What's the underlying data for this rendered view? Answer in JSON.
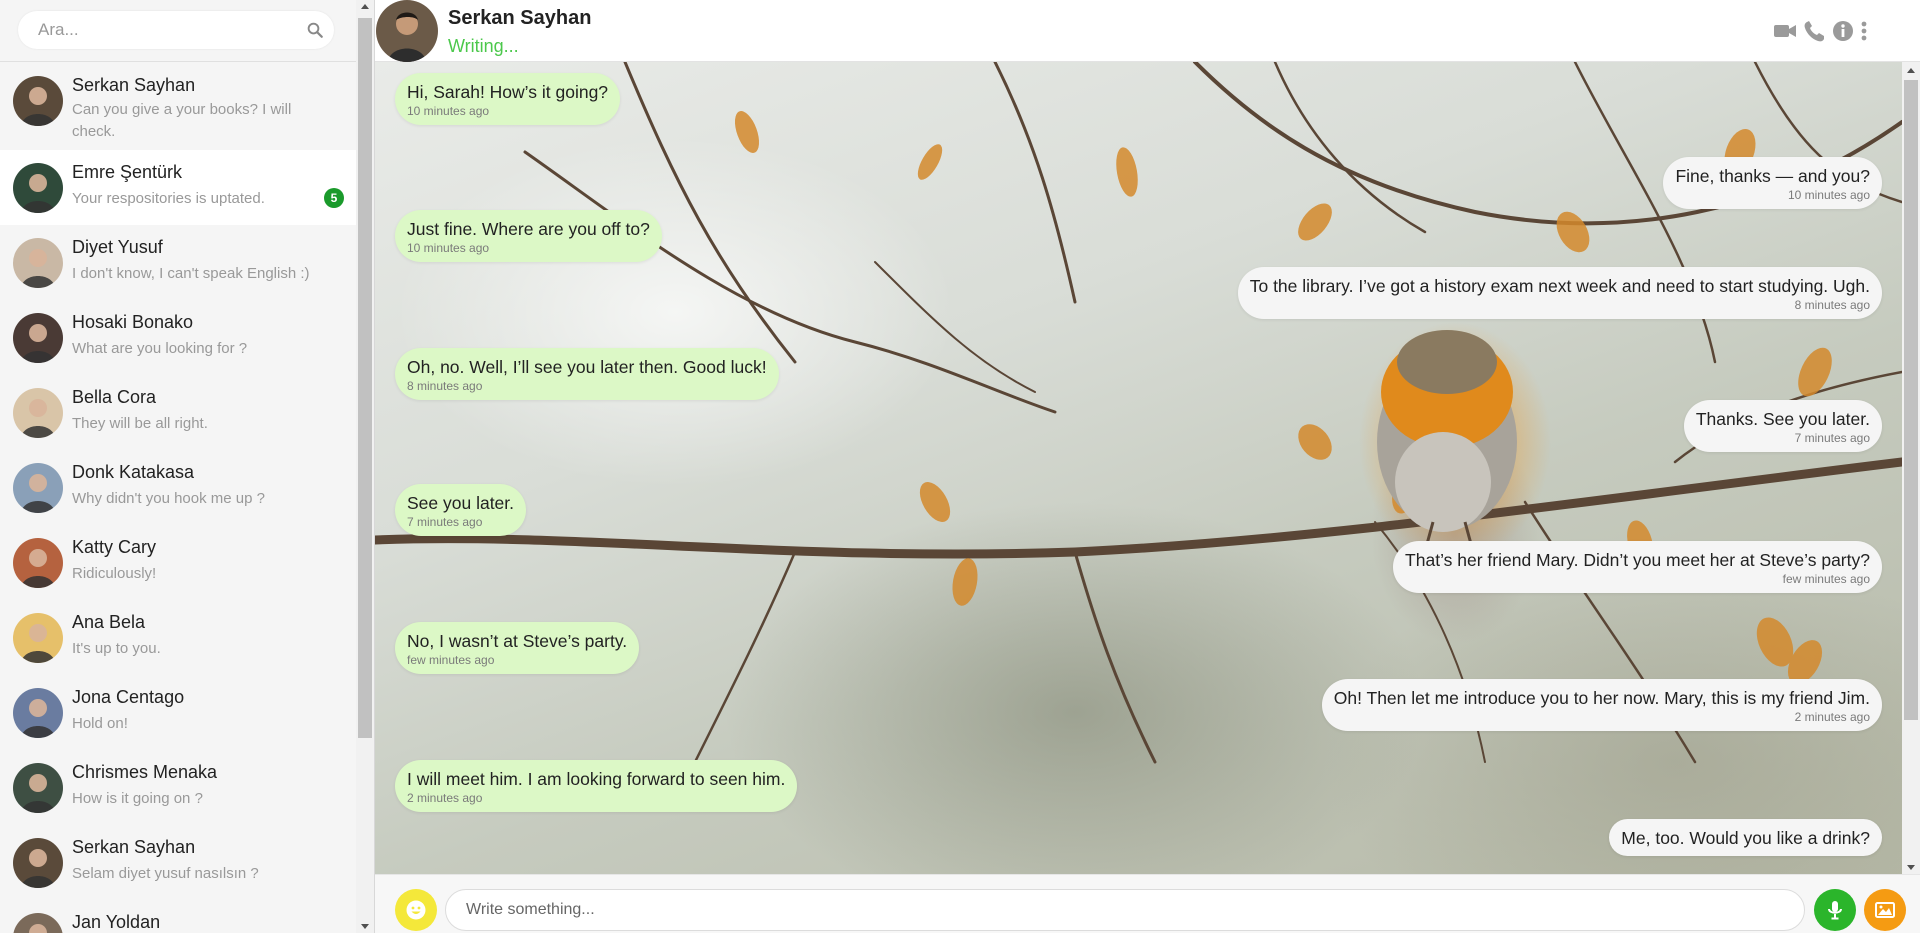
{
  "search": {
    "placeholder": "Ara..."
  },
  "contacts": [
    {
      "name": "Serkan Sayhan",
      "last": "Can you give a your books? I will check.",
      "avatar": "#5a4a3a",
      "active": false
    },
    {
      "name": "Emre Şentürk",
      "last": "Your respositories is uptated.",
      "avatar": "#2f4a3a",
      "active": true,
      "unread": "5"
    },
    {
      "name": "Diyet Yusuf",
      "last": "I don't know, I can't speak English :)",
      "avatar": "#c9b8a5"
    },
    {
      "name": "Hosaki Bonako",
      "last": "What are you looking for ?",
      "avatar": "#4a3a35"
    },
    {
      "name": "Bella Cora",
      "last": "They will be all right.",
      "avatar": "#d9c5a8"
    },
    {
      "name": "Donk Katakasa",
      "last": "Why didn't you hook me up ?",
      "avatar": "#8aa0b8"
    },
    {
      "name": "Katty Cary",
      "last": "Ridiculously!",
      "avatar": "#b5623f"
    },
    {
      "name": "Ana Bela",
      "last": "It's up to you.",
      "avatar": "#e6c06a"
    },
    {
      "name": "Jona Centago",
      "last": "Hold on!",
      "avatar": "#6a7ca0"
    },
    {
      "name": "Chrismes Menaka",
      "last": "How is it going on ?",
      "avatar": "#3e4f43"
    },
    {
      "name": "Serkan Sayhan",
      "last": "Selam diyet yusuf nasılsın ?",
      "avatar": "#5a4a3a"
    },
    {
      "name": "Jan Yoldan",
      "last": "",
      "avatar": "#7b6a5a"
    }
  ],
  "header": {
    "name": "Serkan Sayhan",
    "status": "Writing..."
  },
  "messages": [
    {
      "dir": "in",
      "text": "Hi, Sarah! How’s it going?",
      "time": "10 minutes ago"
    },
    {
      "dir": "out",
      "text": "Fine, thanks — and you?",
      "time": "10 minutes ago"
    },
    {
      "dir": "in",
      "text": "Just fine. Where are you off to?",
      "time": "10 minutes ago"
    },
    {
      "dir": "out",
      "text": "To the library. I’ve got a history exam next week and need to start studying. Ugh.",
      "time": "8 minutes ago"
    },
    {
      "dir": "in",
      "text": "Oh, no. Well, I’ll see you later then. Good luck!",
      "time": "8 minutes ago"
    },
    {
      "dir": "out",
      "text": "Thanks. See you later.",
      "time": "7 minutes ago"
    },
    {
      "dir": "in",
      "text": "See you later.",
      "time": "7 minutes ago"
    },
    {
      "dir": "out",
      "text": "That’s her friend Mary. Didn’t you meet her at Steve’s party?",
      "time": "few minutes ago"
    },
    {
      "dir": "in",
      "text": "No, I wasn’t at Steve’s party.",
      "time": "few minutes ago"
    },
    {
      "dir": "out",
      "text": "Oh! Then let me introduce you to her now. Mary, this is my friend Jim.",
      "time": "2 minutes ago"
    },
    {
      "dir": "in",
      "text": "I will meet him. I am looking forward to seen him.",
      "time": "2 minutes ago"
    },
    {
      "dir": "out",
      "text": "Me, too. Would you like a drink?",
      "time": ""
    }
  ],
  "composer": {
    "placeholder": "Write something..."
  },
  "colors": {
    "accent_green": "#4cc84c",
    "incoming_bubble": "#dcf8c6",
    "badge": "#1a9a2b",
    "emoji_btn": "#f4e83a",
    "mic_btn": "#2bb52b",
    "image_btn": "#f59b12"
  },
  "icons": [
    "search-icon",
    "video-call-icon",
    "phone-icon",
    "info-icon",
    "more-vertical-icon",
    "emoji-icon",
    "microphone-icon",
    "image-icon"
  ]
}
